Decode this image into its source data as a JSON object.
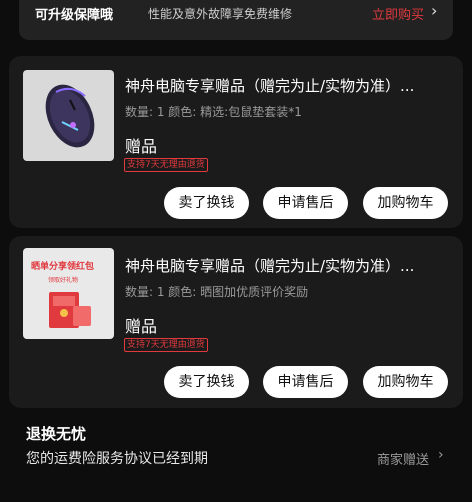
{
  "top_banner": {
    "title": "可升级保障哦",
    "desc": "性能及意外故障享免费维修",
    "cta": "立即购买",
    "chevron": "›"
  },
  "items": [
    {
      "title": "神舟电脑专享赠品（赠完为止/实物为准）...",
      "meta": "数量: 1   颜色: 精选:包鼠垫套装*1",
      "gift": "赠品",
      "tag": "支持7天无理由退货",
      "thumb_icon": "mouse-image",
      "buttons": [
        "卖了换钱",
        "申请售后",
        "加购物车"
      ]
    },
    {
      "title": "神舟电脑专享赠品（赠完为止/实物为准）...",
      "meta": "数量: 1   颜色: 晒图加优质评价奖励",
      "gift": "赠品",
      "tag": "支持7天无理由退货",
      "thumb_icon": "red-envelope-image",
      "thumb_text": "晒单分享领红包",
      "thumb_subtext": "领取好礼物",
      "buttons": [
        "卖了换钱",
        "申请售后",
        "加购物车"
      ]
    }
  ],
  "footer": {
    "title": "退换无忧",
    "subtitle": "您的运费险服务协议已经到期",
    "right_label": "商家赠送",
    "chevron": "›"
  },
  "colors": {
    "background": "#0d0d0d",
    "card": "#1b1b1b",
    "accent_red": "#e0393e",
    "button_bg": "#ffffff"
  }
}
